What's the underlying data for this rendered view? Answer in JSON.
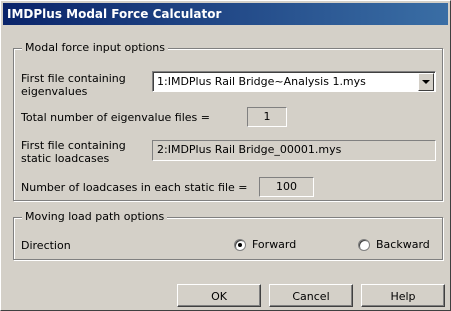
{
  "window": {
    "title": "IMDPlus Modal Force Calculator"
  },
  "modal_force": {
    "group_label": "Modal force input options",
    "first_eigen_label_line1": "First file containing",
    "first_eigen_label_line2": "eigenvalues",
    "first_eigen_value": "1:IMDPlus Rail Bridge~Analysis 1.mys",
    "total_eigen_label": "Total number of eigenvalue files =",
    "total_eigen_value": "1",
    "first_static_label_line1": "First file containing",
    "first_static_label_line2": "static loadcases",
    "first_static_value": "2:IMDPlus Rail Bridge_00001.mys",
    "num_loadcases_label": "Number of loadcases in each static file =",
    "num_loadcases_value": "100"
  },
  "moving_load": {
    "group_label": "Moving load path options",
    "direction_label": "Direction",
    "forward_label": "Forward",
    "backward_label": "Backward",
    "selected": "Forward"
  },
  "buttons": {
    "ok": "OK",
    "cancel": "Cancel",
    "help": "Help"
  },
  "icons": {
    "combo_arrow": "chevron-down-icon"
  }
}
